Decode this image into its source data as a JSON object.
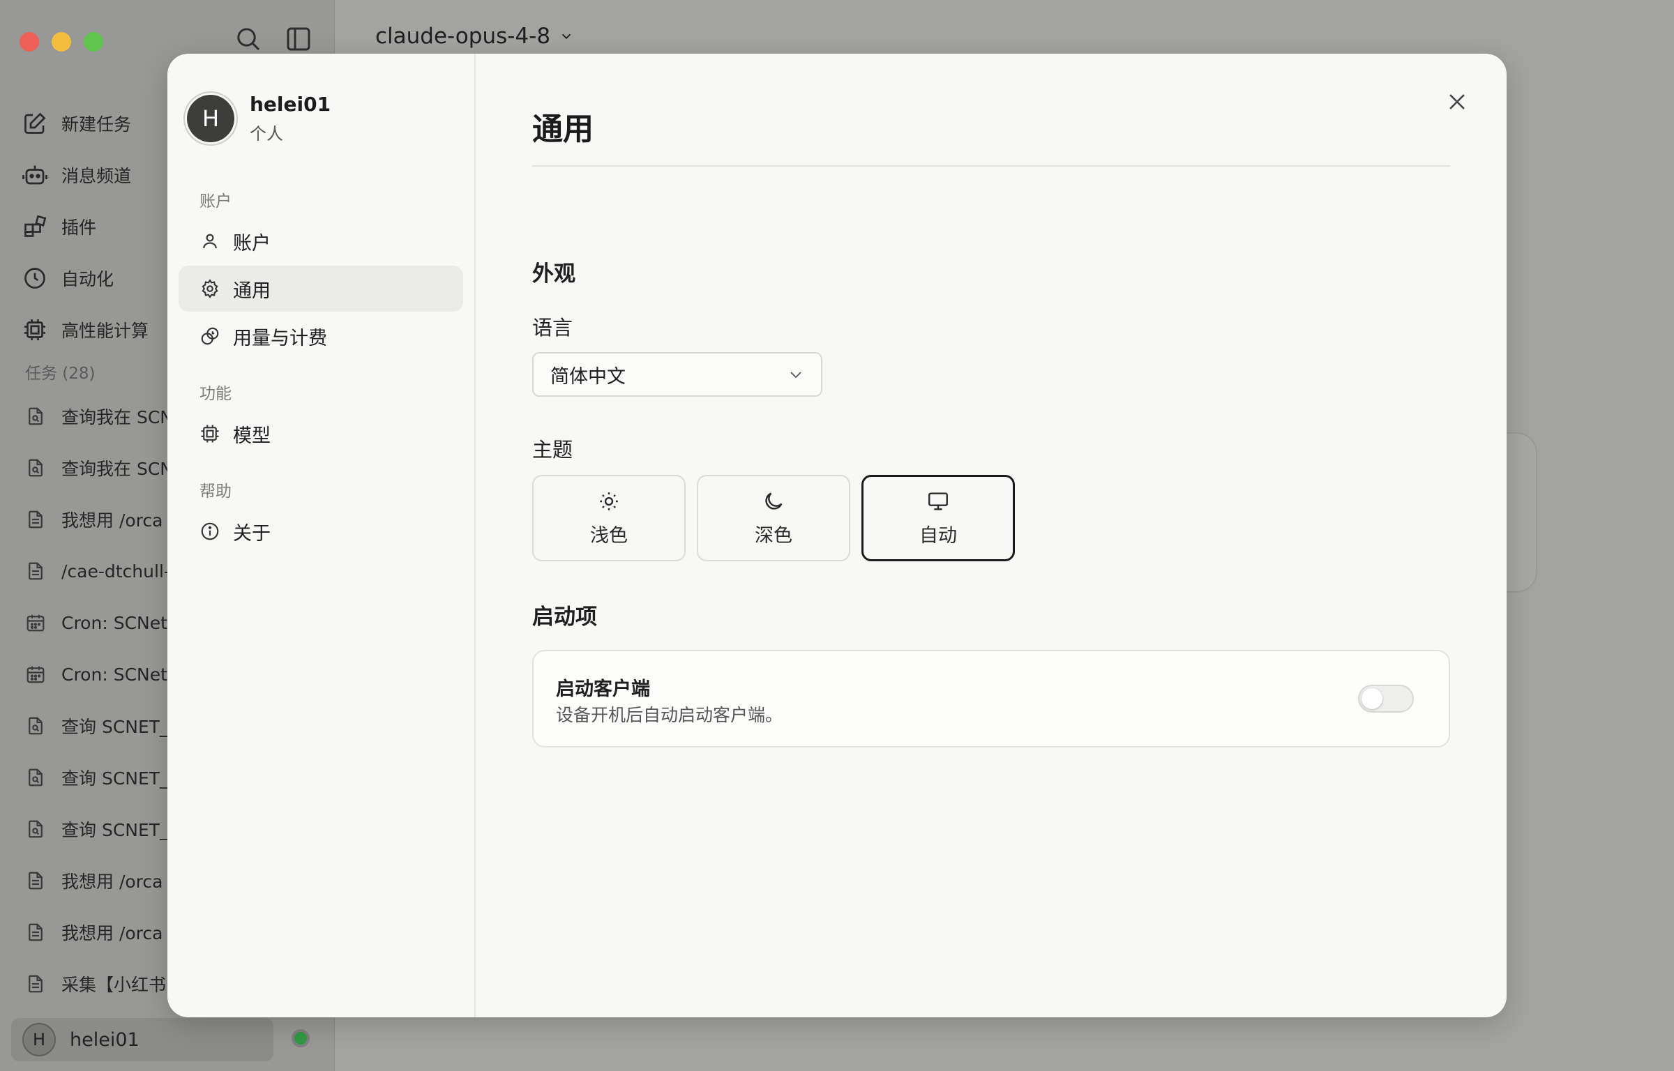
{
  "app": {
    "model_selector": "claude-opus-4-8",
    "nav": [
      {
        "label": "新建任务",
        "icon": "edit-icon"
      },
      {
        "label": "消息频道",
        "icon": "bot-icon"
      },
      {
        "label": "插件",
        "icon": "plugin-icon"
      },
      {
        "label": "自动化",
        "icon": "clock-icon"
      },
      {
        "label": "高性能计算",
        "icon": "chip-icon"
      }
    ],
    "tasks_header": "任务 (28)",
    "tasks": [
      {
        "label": "查询我在 SCN",
        "icon": "doc-search-icon"
      },
      {
        "label": "查询我在 SCN",
        "icon": "doc-search-icon"
      },
      {
        "label": "我想用 /orca",
        "icon": "doc-icon"
      },
      {
        "label": "/cae-dtchull-",
        "icon": "doc-icon"
      },
      {
        "label": "Cron: SCNet",
        "icon": "calendar-icon"
      },
      {
        "label": "Cron: SCNet",
        "icon": "calendar-icon"
      },
      {
        "label": "查询 SCNET_",
        "icon": "doc-search-icon"
      },
      {
        "label": "查询 SCNET_",
        "icon": "doc-search-icon"
      },
      {
        "label": "查询 SCNET_",
        "icon": "doc-search-icon"
      },
      {
        "label": "我想用 /orca",
        "icon": "doc-icon"
      },
      {
        "label": "我想用 /orca",
        "icon": "doc-icon"
      },
      {
        "label": "采集【小红书",
        "icon": "doc-icon"
      }
    ],
    "user": {
      "initial": "H",
      "name": "helei01",
      "status_color": "#2f9a41"
    }
  },
  "settings": {
    "profile": {
      "initial": "H",
      "name": "helei01",
      "plan": "个人"
    },
    "sections": [
      {
        "label": "账户",
        "items": [
          {
            "label": "账户"
          },
          {
            "label": "通用",
            "active": true
          },
          {
            "label": "用量与计费"
          }
        ]
      },
      {
        "label": "功能",
        "items": [
          {
            "label": "模型"
          }
        ]
      },
      {
        "label": "帮助",
        "items": [
          {
            "label": "关于"
          }
        ]
      }
    ],
    "page_title": "通用",
    "appearance": {
      "heading": "外观",
      "language_label": "语言",
      "language_value": "简体中文",
      "theme_label": "主题",
      "themes": [
        {
          "label": "浅色",
          "icon": "sun-icon",
          "selected": false
        },
        {
          "label": "深色",
          "icon": "moon-icon",
          "selected": false
        },
        {
          "label": "自动",
          "icon": "monitor-icon",
          "selected": true
        }
      ]
    },
    "startup": {
      "heading": "启动项",
      "item_title": "启动客户端",
      "item_desc": "设备开机后自动启动客户端。",
      "enabled": false
    }
  }
}
